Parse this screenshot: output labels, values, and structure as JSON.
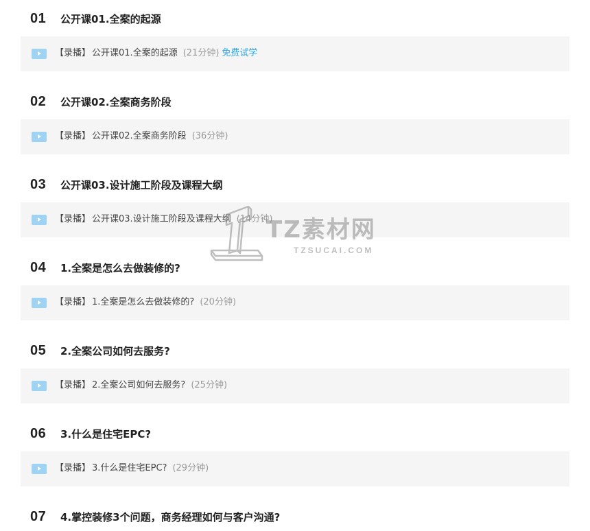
{
  "chapters": [
    {
      "num": "01",
      "title": "公开课01.全案的起源",
      "lesson": {
        "tag": "【录播】",
        "title": "公开课01.全案的起源",
        "duration": "(21分钟)",
        "free": "免费试学"
      }
    },
    {
      "num": "02",
      "title": "公开课02.全案商务阶段",
      "lesson": {
        "tag": "【录播】",
        "title": "公开课02.全案商务阶段",
        "duration": "(36分钟)",
        "free": ""
      }
    },
    {
      "num": "03",
      "title": "公开课03.设计施工阶段及课程大纲",
      "lesson": {
        "tag": "【录播】",
        "title": "公开课03.设计施工阶段及课程大纲",
        "duration": "(14分钟)",
        "free": ""
      }
    },
    {
      "num": "04",
      "title": "1.全案是怎么去做装修的?",
      "lesson": {
        "tag": "【录播】",
        "title": "1.全案是怎么去做装修的?",
        "duration": "(20分钟)",
        "free": ""
      }
    },
    {
      "num": "05",
      "title": "2.全案公司如何去服务?",
      "lesson": {
        "tag": "【录播】",
        "title": "2.全案公司如何去服务?",
        "duration": "(25分钟)",
        "free": ""
      }
    },
    {
      "num": "06",
      "title": "3.什么是住宅EPC?",
      "lesson": {
        "tag": "【录播】",
        "title": "3.什么是住宅EPC?",
        "duration": "(29分钟)",
        "free": ""
      }
    },
    {
      "num": "07",
      "title": "4.掌控装修3个问题，商务经理如何与客户沟通?"
    }
  ],
  "watermark": {
    "text": "TZ素材网",
    "sub": "TZSUCAI.COM"
  },
  "colors": {
    "lesson_bg": "#f5f5f5",
    "play_icon": "#9fd3f3",
    "free_link": "#2ea7e0",
    "duration": "#999999"
  },
  "icons": {
    "play": "play-video-icon"
  }
}
